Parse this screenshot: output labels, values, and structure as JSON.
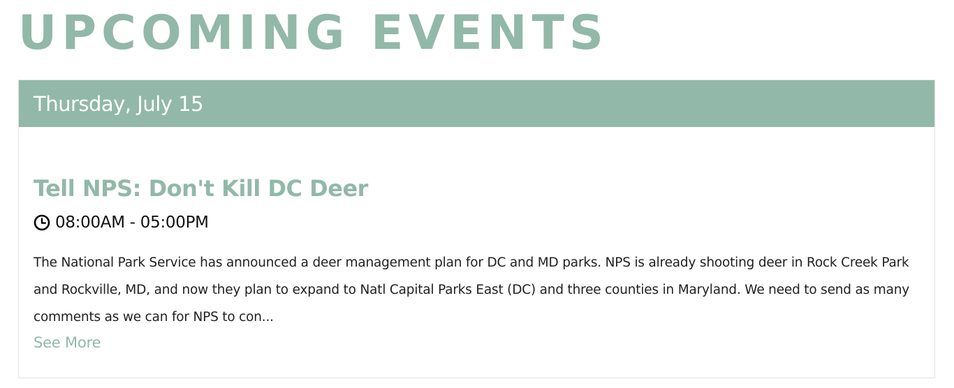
{
  "page": {
    "heading": "UPCOMING EVENTS"
  },
  "colors": {
    "accent": "#92b8a9",
    "text": "#222222",
    "card_border": "#e3e3e3"
  },
  "event": {
    "date": "Thursday, July 15",
    "title": "Tell NPS: Don't Kill DC Deer",
    "time_icon": "clock-icon",
    "time": "08:00AM - 05:00PM",
    "description": "The National Park Service has announced a deer management plan for DC and MD parks. NPS is already shooting deer in Rock Creek Park and Rockville, MD, and now they plan to expand to Natl Capital Parks East (DC) and three counties in Maryland. We need to send as many comments as we can for NPS to con...",
    "see_more_label": "See More"
  }
}
